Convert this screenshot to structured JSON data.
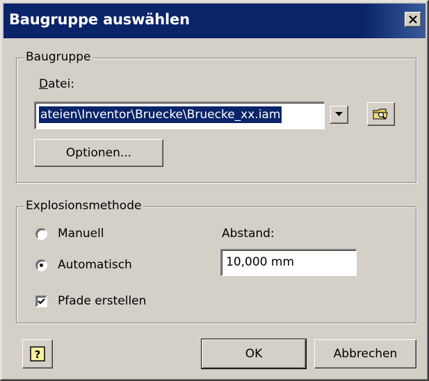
{
  "window": {
    "title": "Baugruppe auswählen",
    "close_icon": "close-icon"
  },
  "assembly_group": {
    "label": "Baugruppe",
    "file_label_mnemonic": "D",
    "file_label_rest": "atei:",
    "file_value": "ateien\\Inventor\\Bruecke\\Bruecke_xx.iam",
    "dropdown_icon": "chevron-down-icon",
    "browse_icon": "folder-search-icon",
    "options_button": "Optionen..."
  },
  "explosion_group": {
    "label": "Explosionsmethode",
    "radio_manual": "Manuell",
    "radio_auto": "Automatisch",
    "selected": "Automatisch",
    "distance_label": "Abstand:",
    "distance_value": "10,000 mm",
    "checkbox_paths": "Pfade erstellen",
    "checkbox_paths_checked": true
  },
  "footer": {
    "help_icon": "help-icon",
    "ok": "OK",
    "cancel": "Abbrechen"
  }
}
